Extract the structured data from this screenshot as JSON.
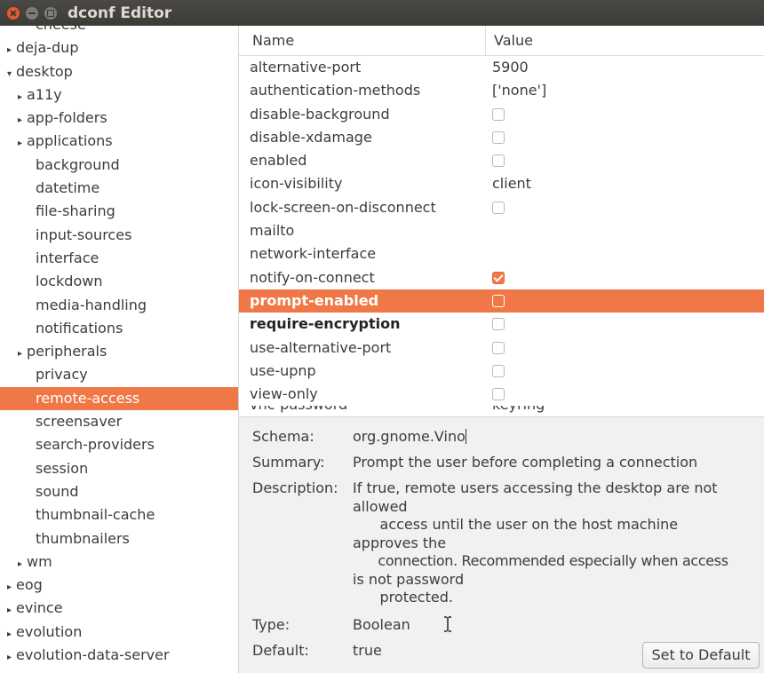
{
  "window": {
    "title": "dconf Editor"
  },
  "tree": {
    "items": [
      {
        "label": "cheese",
        "level": 1,
        "arrow": ""
      },
      {
        "label": "deja-dup",
        "level": 0,
        "arrow": "collapsed"
      },
      {
        "label": "desktop",
        "level": 0,
        "arrow": "expanded"
      },
      {
        "label": "a11y",
        "level": 1,
        "arrow": "collapsed"
      },
      {
        "label": "app-folders",
        "level": 1,
        "arrow": "collapsed"
      },
      {
        "label": "applications",
        "level": 1,
        "arrow": "collapsed"
      },
      {
        "label": "background",
        "level": 2,
        "arrow": ""
      },
      {
        "label": "datetime",
        "level": 2,
        "arrow": ""
      },
      {
        "label": "file-sharing",
        "level": 2,
        "arrow": ""
      },
      {
        "label": "input-sources",
        "level": 2,
        "arrow": ""
      },
      {
        "label": "interface",
        "level": 2,
        "arrow": ""
      },
      {
        "label": "lockdown",
        "level": 2,
        "arrow": ""
      },
      {
        "label": "media-handling",
        "level": 2,
        "arrow": ""
      },
      {
        "label": "notifications",
        "level": 2,
        "arrow": ""
      },
      {
        "label": "peripherals",
        "level": 1,
        "arrow": "collapsed"
      },
      {
        "label": "privacy",
        "level": 2,
        "arrow": ""
      },
      {
        "label": "remote-access",
        "level": 2,
        "arrow": "",
        "selected": true
      },
      {
        "label": "screensaver",
        "level": 2,
        "arrow": ""
      },
      {
        "label": "search-providers",
        "level": 2,
        "arrow": ""
      },
      {
        "label": "session",
        "level": 2,
        "arrow": ""
      },
      {
        "label": "sound",
        "level": 2,
        "arrow": ""
      },
      {
        "label": "thumbnail-cache",
        "level": 2,
        "arrow": ""
      },
      {
        "label": "thumbnailers",
        "level": 2,
        "arrow": ""
      },
      {
        "label": "wm",
        "level": 1,
        "arrow": "collapsed"
      },
      {
        "label": "eog",
        "level": 0,
        "arrow": "collapsed"
      },
      {
        "label": "evince",
        "level": 0,
        "arrow": "collapsed"
      },
      {
        "label": "evolution",
        "level": 0,
        "arrow": "collapsed"
      },
      {
        "label": "evolution-data-server",
        "level": 0,
        "arrow": "collapsed"
      }
    ]
  },
  "table": {
    "columns": [
      "Name",
      "Value"
    ],
    "rows": [
      {
        "name": "alternative-port",
        "type": "text",
        "value": "5900"
      },
      {
        "name": "authentication-methods",
        "type": "text",
        "value": "['none']"
      },
      {
        "name": "disable-background",
        "type": "check",
        "checked": false
      },
      {
        "name": "disable-xdamage",
        "type": "check",
        "checked": false
      },
      {
        "name": "enabled",
        "type": "check",
        "checked": false
      },
      {
        "name": "icon-visibility",
        "type": "text",
        "value": "client"
      },
      {
        "name": "lock-screen-on-disconnect",
        "type": "check",
        "checked": false
      },
      {
        "name": "mailto",
        "type": "text",
        "value": ""
      },
      {
        "name": "network-interface",
        "type": "text",
        "value": ""
      },
      {
        "name": "notify-on-connect",
        "type": "check",
        "checked": true
      },
      {
        "name": "prompt-enabled",
        "type": "check",
        "checked": false,
        "selected": true
      },
      {
        "name": "require-encryption",
        "type": "check",
        "checked": false,
        "bold": true
      },
      {
        "name": "use-alternative-port",
        "type": "check",
        "checked": false
      },
      {
        "name": "use-upnp",
        "type": "check",
        "checked": false
      },
      {
        "name": "view-only",
        "type": "check",
        "checked": false
      },
      {
        "name": "vnc-password",
        "type": "text",
        "value": "keyring",
        "cut": true
      }
    ]
  },
  "details": {
    "schema_label": "Schema:",
    "schema_value": "org.gnome.Vino",
    "summary_label": "Summary:",
    "summary_value": "Prompt the user before completing a connection",
    "description_label": "Description:",
    "description_lines": [
      "If true, remote users accessing the desktop are not",
      "allowed",
      "      access until the user on the host machine",
      "approves the",
      "      connection. Recommended especially when access",
      "is not password",
      "      protected."
    ],
    "type_label": "Type:",
    "type_value": "Boolean",
    "default_label": "Default:",
    "default_value": "true",
    "set_default_label": "Set to Default"
  },
  "colors": {
    "selection": "#f07746",
    "titlebar": "#3c3b37",
    "details_bg": "#f2f1f0"
  }
}
